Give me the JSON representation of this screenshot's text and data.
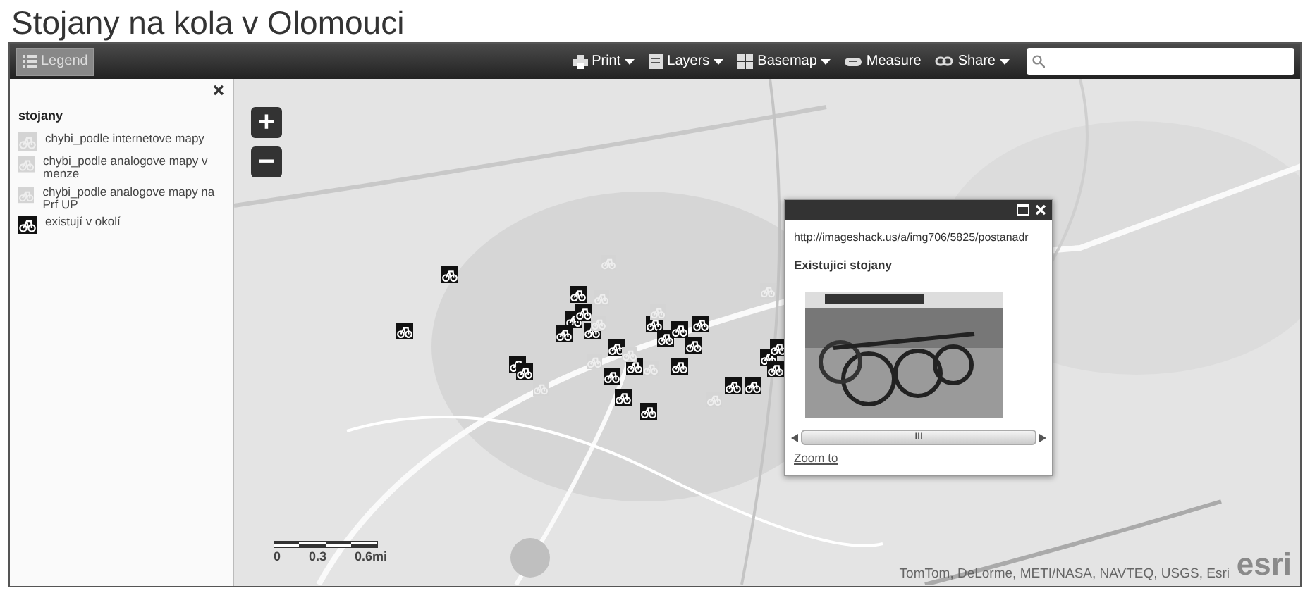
{
  "title": "Stojany na kola v Olomouci",
  "toolbar": {
    "legend_button": {
      "label": "Legend",
      "selected": true
    },
    "tools": [
      {
        "label": "Print",
        "kind": "print",
        "dropdown": true
      },
      {
        "label": "Layers",
        "kind": "layers",
        "dropdown": true
      },
      {
        "label": "Basemap",
        "kind": "basemap",
        "dropdown": true
      },
      {
        "label": "Measure",
        "kind": "measure",
        "dropdown": false
      },
      {
        "label": "Share",
        "kind": "share",
        "dropdown": true
      }
    ]
  },
  "legend": {
    "layer": "stojany",
    "items": [
      {
        "label": "chybi_podle internetove mapy",
        "kind": "missing"
      },
      {
        "label": "chybi_podle analogove mapy v menze",
        "kind": "missing"
      },
      {
        "label": "chybi_podle analogove mapy na Prf UP",
        "kind": "missing"
      },
      {
        "label": "existují v okolí",
        "kind": "existing"
      }
    ]
  },
  "map": {
    "zoom_in": "+",
    "zoom_out": "−",
    "scale": [
      "0",
      "0.3",
      "0.6mi"
    ],
    "attribution": "TomTom, DeLorme, METI/NASA, NAVTEQ, USGS, Esri",
    "logo": "esri",
    "popup": {
      "url": "http://imageshack.us/a/img706/5825/postanadr",
      "title": "Existujici stojany",
      "link": "Zoom to",
      "scroll_label": "III"
    }
  }
}
